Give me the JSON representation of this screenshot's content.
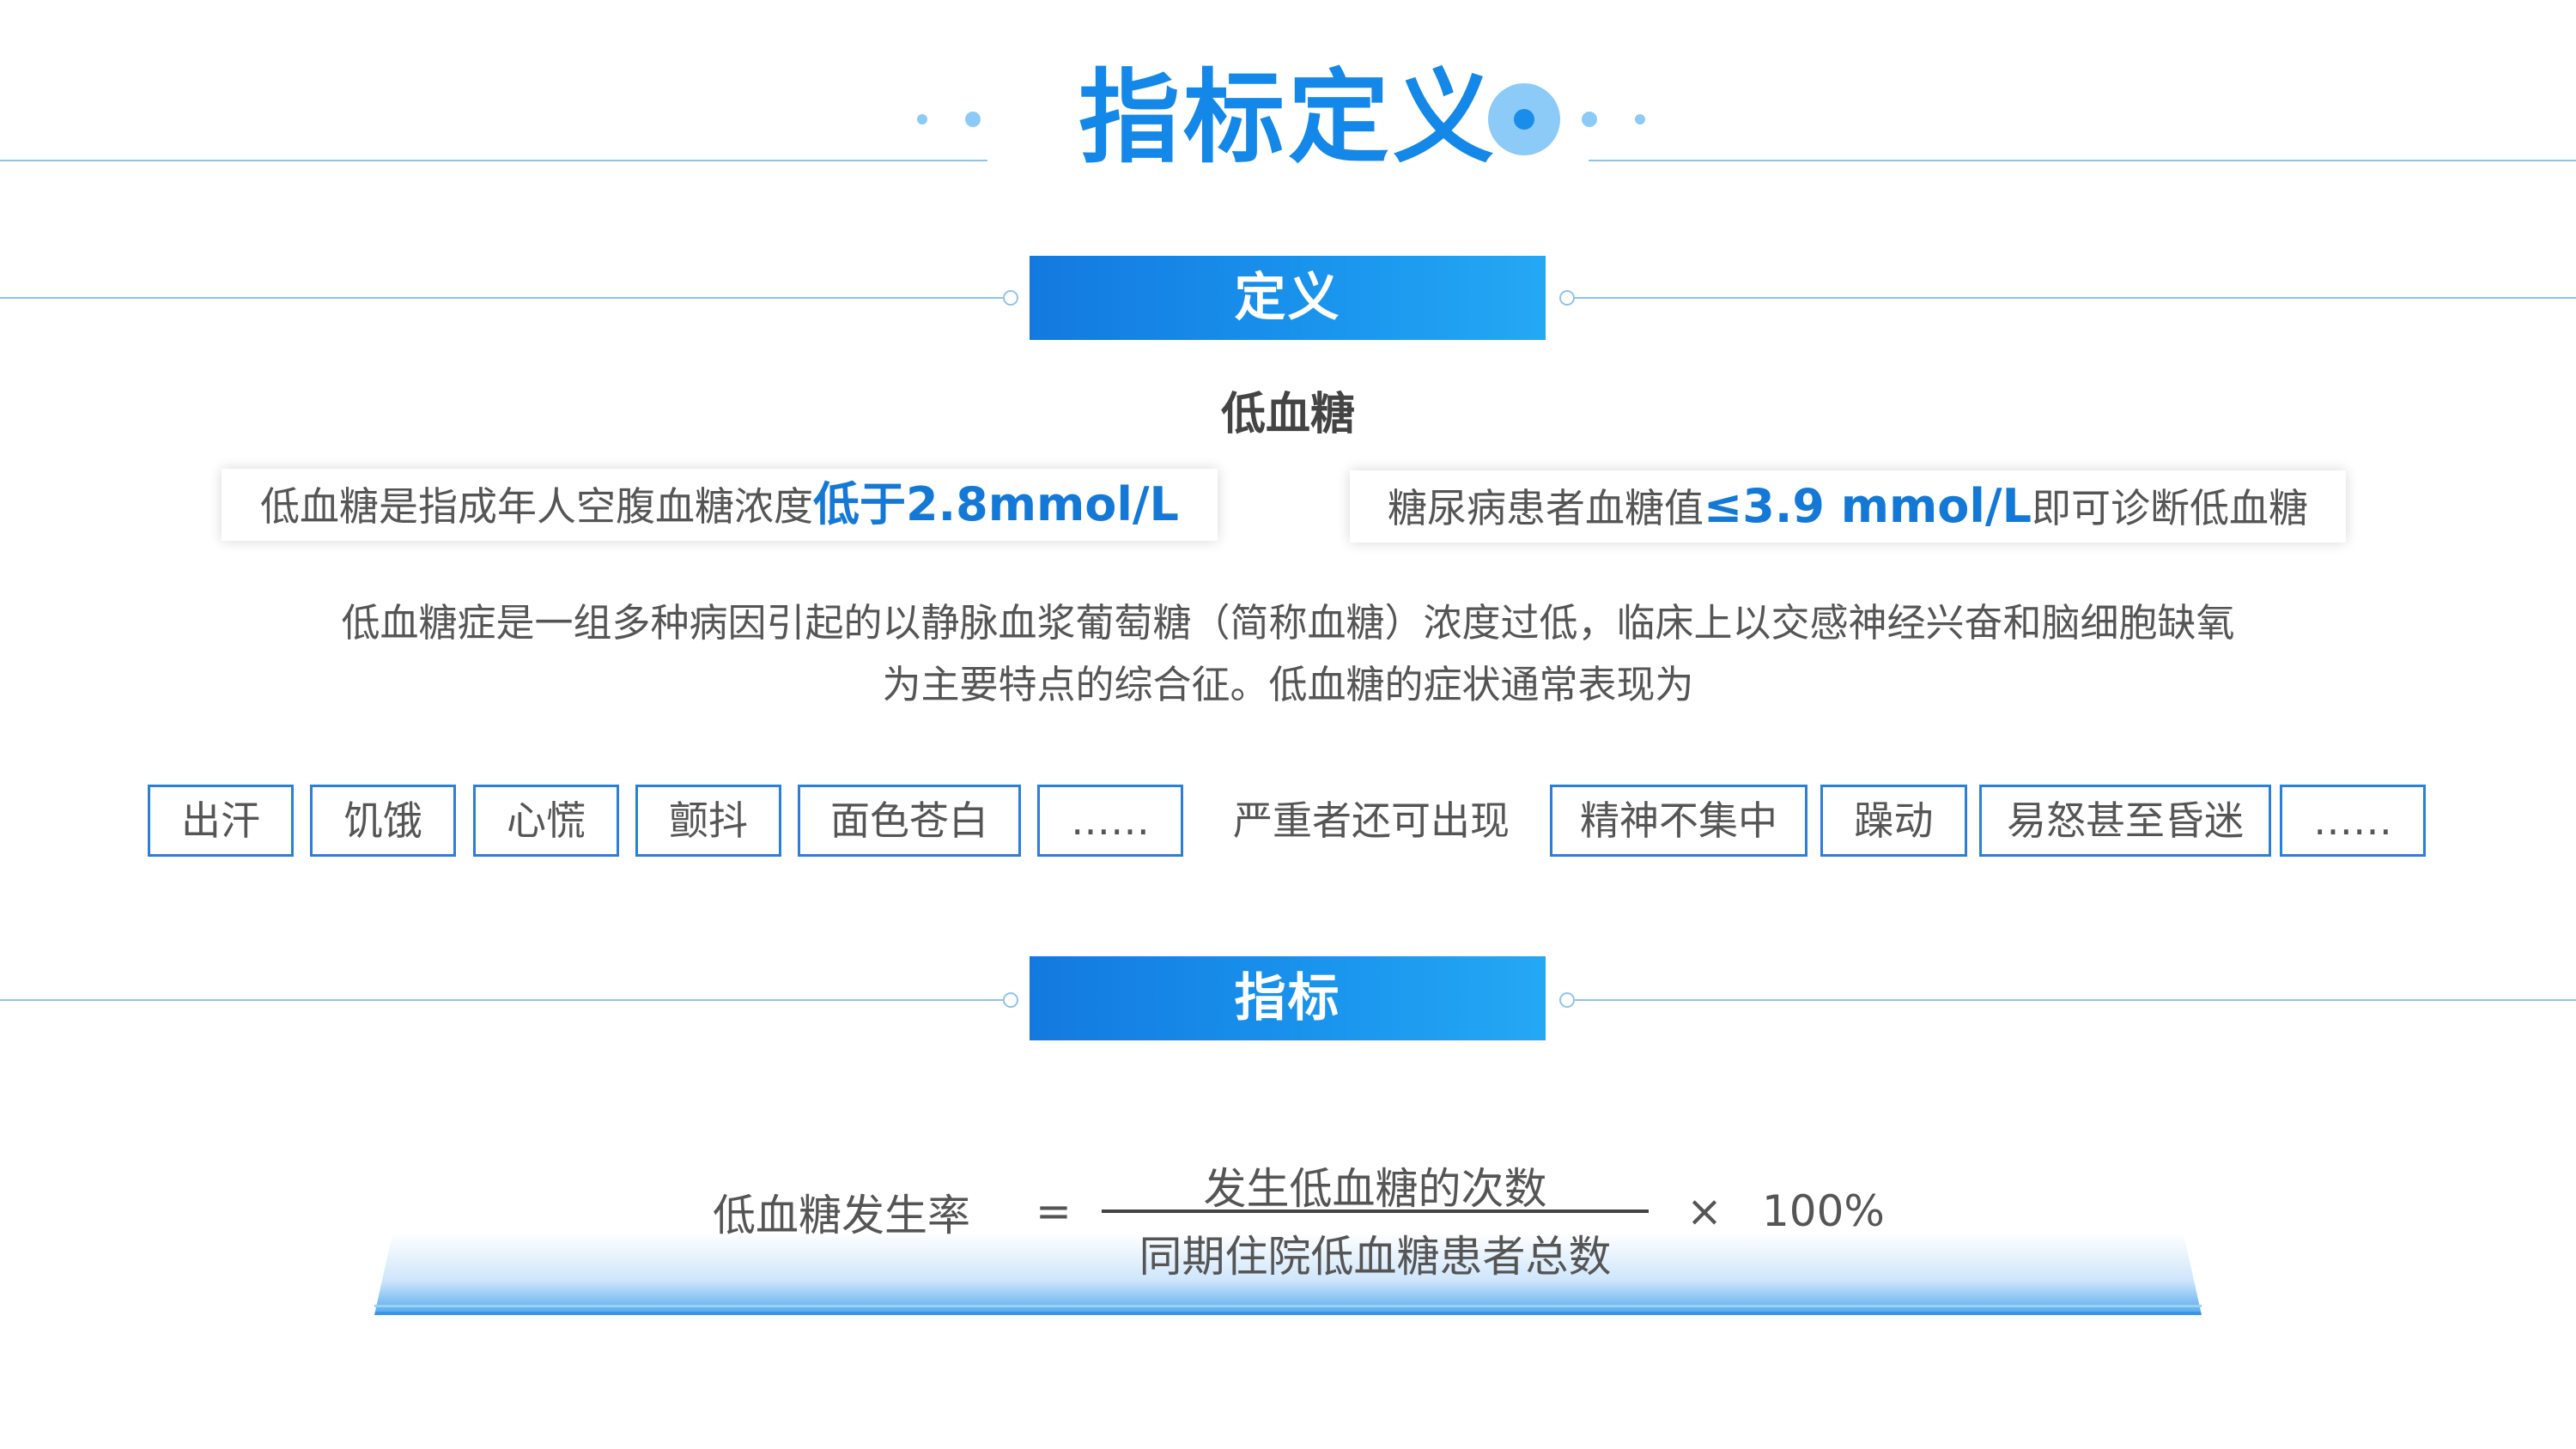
{
  "page_title": "指标定义",
  "sections": {
    "definition_label": "定义",
    "indicator_label": "指标"
  },
  "definition": {
    "subtitle": "低血糖",
    "criteria": [
      {
        "prefix": "低血糖是指成年人空腹血糖浓度",
        "highlight": "低于2.8mmol/L",
        "suffix": ""
      },
      {
        "prefix": "糖尿病患者血糖值",
        "highlight": "≤3.9 mmol/L",
        "suffix": "即可诊断低血糖"
      }
    ],
    "paragraph_line1": "低血糖症是一组多种病因引起的以静脉血浆葡萄糖（简称血糖）浓度过低，临床上以交感神经兴奋和脑细胞缺氧",
    "paragraph_line2": "为主要特点的综合征。低血糖的症状通常表现为"
  },
  "symptoms": {
    "common": [
      "出汗",
      "饥饿",
      "心慌",
      "颤抖",
      "面色苍白",
      "……"
    ],
    "severe_label": "严重者还可出现",
    "severe": [
      "精神不集中",
      "躁动",
      "易怒甚至昏迷",
      "……"
    ]
  },
  "formula": {
    "name": "低血糖发生率",
    "equals": "=",
    "numerator": "发生低血糖的次数",
    "denominator": "同期住院低血糖患者总数",
    "times": "×",
    "factor": "100%"
  },
  "colors": {
    "accent": "#1488e8",
    "header_gradient_start": "#1379e0",
    "header_gradient_end": "#25a8f4",
    "highlight_text": "#1479d6",
    "tag_border": "#2a7fd6",
    "line": "#8fc3ec"
  }
}
